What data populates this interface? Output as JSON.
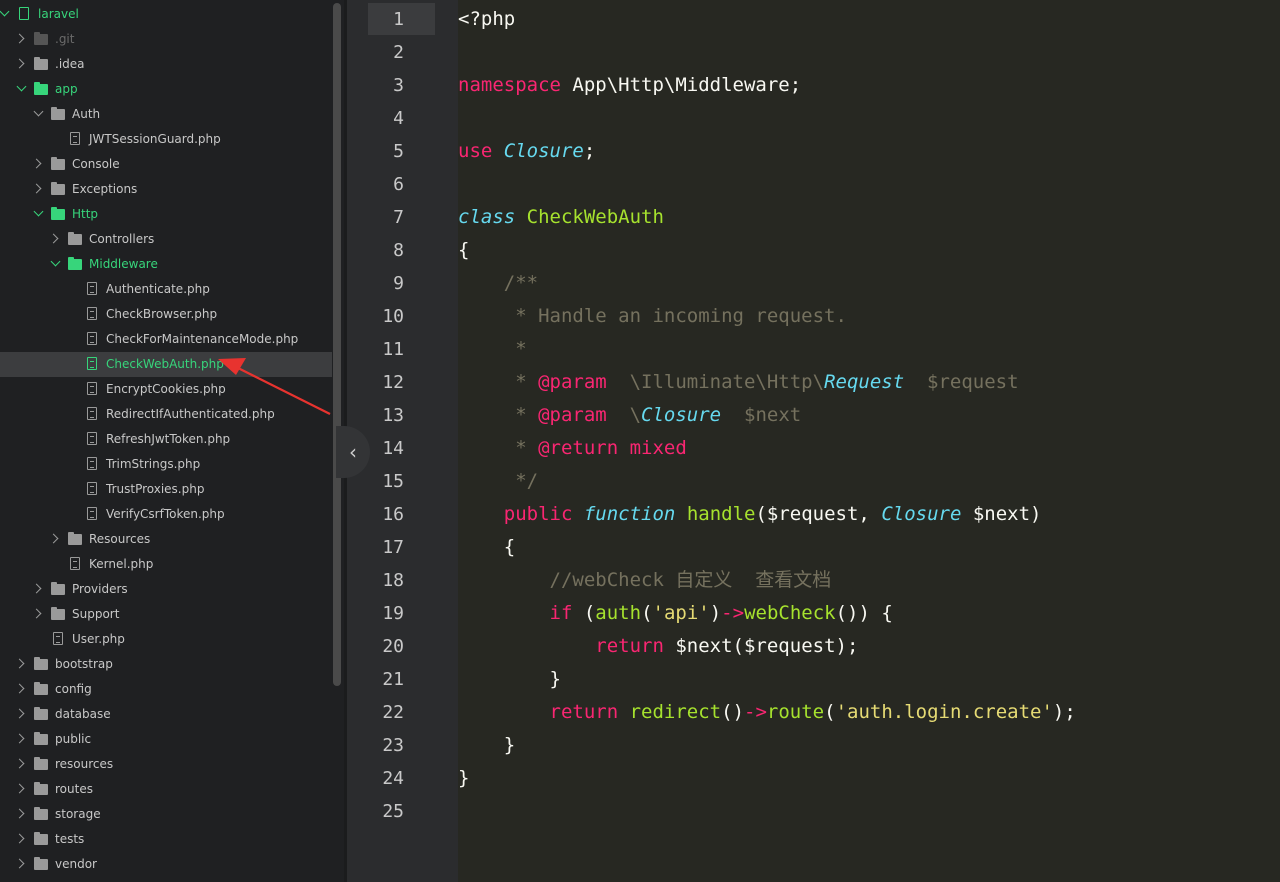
{
  "sidebar": {
    "items": [
      {
        "label": "laravel",
        "type": "repo",
        "depth": 0,
        "chevron": "down",
        "state": "green"
      },
      {
        "label": ".git",
        "type": "folder",
        "depth": 1,
        "chevron": "right",
        "state": "dim"
      },
      {
        "label": ".idea",
        "type": "folder",
        "depth": 1,
        "chevron": "right",
        "state": "normal"
      },
      {
        "label": "app",
        "type": "folder",
        "depth": 1,
        "chevron": "down",
        "state": "green"
      },
      {
        "label": "Auth",
        "type": "folder",
        "depth": 2,
        "chevron": "down",
        "state": "normal"
      },
      {
        "label": "JWTSessionGuard.php",
        "type": "file",
        "depth": 3,
        "chevron": "none",
        "state": "normal"
      },
      {
        "label": "Console",
        "type": "folder",
        "depth": 2,
        "chevron": "right",
        "state": "normal"
      },
      {
        "label": "Exceptions",
        "type": "folder",
        "depth": 2,
        "chevron": "right",
        "state": "normal"
      },
      {
        "label": "Http",
        "type": "folder",
        "depth": 2,
        "chevron": "down",
        "state": "green"
      },
      {
        "label": "Controllers",
        "type": "folder",
        "depth": 3,
        "chevron": "right",
        "state": "normal"
      },
      {
        "label": "Middleware",
        "type": "folder",
        "depth": 3,
        "chevron": "down",
        "state": "green"
      },
      {
        "label": "Authenticate.php",
        "type": "file",
        "depth": 4,
        "chevron": "none",
        "state": "normal"
      },
      {
        "label": "CheckBrowser.php",
        "type": "file",
        "depth": 4,
        "chevron": "none",
        "state": "normal"
      },
      {
        "label": "CheckForMaintenanceMode.php",
        "type": "file",
        "depth": 4,
        "chevron": "none",
        "state": "normal"
      },
      {
        "label": "CheckWebAuth.php",
        "type": "file",
        "depth": 4,
        "chevron": "none",
        "state": "selected"
      },
      {
        "label": "EncryptCookies.php",
        "type": "file",
        "depth": 4,
        "chevron": "none",
        "state": "normal"
      },
      {
        "label": "RedirectIfAuthenticated.php",
        "type": "file",
        "depth": 4,
        "chevron": "none",
        "state": "normal"
      },
      {
        "label": "RefreshJwtToken.php",
        "type": "file",
        "depth": 4,
        "chevron": "none",
        "state": "normal"
      },
      {
        "label": "TrimStrings.php",
        "type": "file",
        "depth": 4,
        "chevron": "none",
        "state": "normal"
      },
      {
        "label": "TrustProxies.php",
        "type": "file",
        "depth": 4,
        "chevron": "none",
        "state": "normal"
      },
      {
        "label": "VerifyCsrfToken.php",
        "type": "file",
        "depth": 4,
        "chevron": "none",
        "state": "normal"
      },
      {
        "label": "Resources",
        "type": "folder",
        "depth": 3,
        "chevron": "right",
        "state": "normal"
      },
      {
        "label": "Kernel.php",
        "type": "file",
        "depth": 3,
        "chevron": "none",
        "state": "normal"
      },
      {
        "label": "Providers",
        "type": "folder",
        "depth": 2,
        "chevron": "right",
        "state": "normal"
      },
      {
        "label": "Support",
        "type": "folder",
        "depth": 2,
        "chevron": "right",
        "state": "normal"
      },
      {
        "label": "User.php",
        "type": "file",
        "depth": 2,
        "chevron": "none",
        "state": "normal"
      },
      {
        "label": "bootstrap",
        "type": "folder",
        "depth": 1,
        "chevron": "right",
        "state": "normal"
      },
      {
        "label": "config",
        "type": "folder",
        "depth": 1,
        "chevron": "right",
        "state": "normal"
      },
      {
        "label": "database",
        "type": "folder",
        "depth": 1,
        "chevron": "right",
        "state": "normal"
      },
      {
        "label": "public",
        "type": "folder",
        "depth": 1,
        "chevron": "right",
        "state": "normal"
      },
      {
        "label": "resources",
        "type": "folder",
        "depth": 1,
        "chevron": "right",
        "state": "normal"
      },
      {
        "label": "routes",
        "type": "folder",
        "depth": 1,
        "chevron": "right",
        "state": "normal"
      },
      {
        "label": "storage",
        "type": "folder",
        "depth": 1,
        "chevron": "right",
        "state": "normal"
      },
      {
        "label": "tests",
        "type": "folder",
        "depth": 1,
        "chevron": "right",
        "state": "normal"
      },
      {
        "label": "vendor",
        "type": "folder",
        "depth": 1,
        "chevron": "right",
        "state": "normal"
      }
    ]
  },
  "editor": {
    "current_line": 1,
    "lines": [
      [
        [
          "<?php",
          "p"
        ]
      ],
      [],
      [
        [
          "namespace",
          "k"
        ],
        [
          " App\\Http\\Middleware;",
          "p"
        ]
      ],
      [],
      [
        [
          "use",
          "k"
        ],
        [
          " ",
          "p"
        ],
        [
          "Closure",
          "t"
        ],
        [
          ";",
          "p"
        ]
      ],
      [],
      [
        [
          "class",
          "t"
        ],
        [
          " ",
          "p"
        ],
        [
          "CheckWebAuth",
          "c"
        ]
      ],
      [
        [
          "{",
          "p"
        ]
      ],
      [
        [
          "    /**",
          "cm"
        ]
      ],
      [
        [
          "     * Handle an incoming request.",
          "cm"
        ]
      ],
      [
        [
          "     *",
          "cm"
        ]
      ],
      [
        [
          "     * ",
          "cm"
        ],
        [
          "@param",
          "k"
        ],
        [
          "  \\Illuminate\\Http\\",
          "cm"
        ],
        [
          "Request",
          "t"
        ],
        [
          "  $request",
          "cm"
        ]
      ],
      [
        [
          "     * ",
          "cm"
        ],
        [
          "@param",
          "k"
        ],
        [
          "  \\",
          "cm"
        ],
        [
          "Closure",
          "t"
        ],
        [
          "  $next",
          "cm"
        ]
      ],
      [
        [
          "     * ",
          "cm"
        ],
        [
          "@return",
          "k"
        ],
        [
          " ",
          "cm"
        ],
        [
          "mixed",
          "k"
        ]
      ],
      [
        [
          "     */",
          "cm"
        ]
      ],
      [
        [
          "    ",
          "p"
        ],
        [
          "public",
          "k"
        ],
        [
          " ",
          "p"
        ],
        [
          "function",
          "t"
        ],
        [
          " ",
          "p"
        ],
        [
          "handle",
          "c"
        ],
        [
          "($request, ",
          "p"
        ],
        [
          "Closure",
          "t"
        ],
        [
          " $next)",
          "p"
        ]
      ],
      [
        [
          "    {",
          "p"
        ]
      ],
      [
        [
          "        //webCheck 自定义  查看文档",
          "cm"
        ]
      ],
      [
        [
          "        ",
          "p"
        ],
        [
          "if",
          "k"
        ],
        [
          " (",
          "p"
        ],
        [
          "auth",
          "c"
        ],
        [
          "(",
          "p"
        ],
        [
          "'api'",
          "s"
        ],
        [
          ")",
          "p"
        ],
        [
          "->",
          "k"
        ],
        [
          "webCheck",
          "c"
        ],
        [
          "()) {",
          "p"
        ]
      ],
      [
        [
          "            ",
          "p"
        ],
        [
          "return",
          "k"
        ],
        [
          " $next($request);",
          "p"
        ]
      ],
      [
        [
          "        }",
          "p"
        ]
      ],
      [
        [
          "        ",
          "p"
        ],
        [
          "return",
          "k"
        ],
        [
          " ",
          "p"
        ],
        [
          "redirect",
          "c"
        ],
        [
          "()",
          "p"
        ],
        [
          "->",
          "k"
        ],
        [
          "route",
          "c"
        ],
        [
          "(",
          "p"
        ],
        [
          "'auth.login.create'",
          "s"
        ],
        [
          ");",
          "p"
        ]
      ],
      [
        [
          "    }",
          "p"
        ]
      ],
      [
        [
          "}",
          "p"
        ]
      ],
      []
    ]
  },
  "collapse_button": {
    "glyph": "‹"
  },
  "colors": {
    "annotation_arrow": "#e8332f",
    "accent_green": "#37d57b"
  }
}
